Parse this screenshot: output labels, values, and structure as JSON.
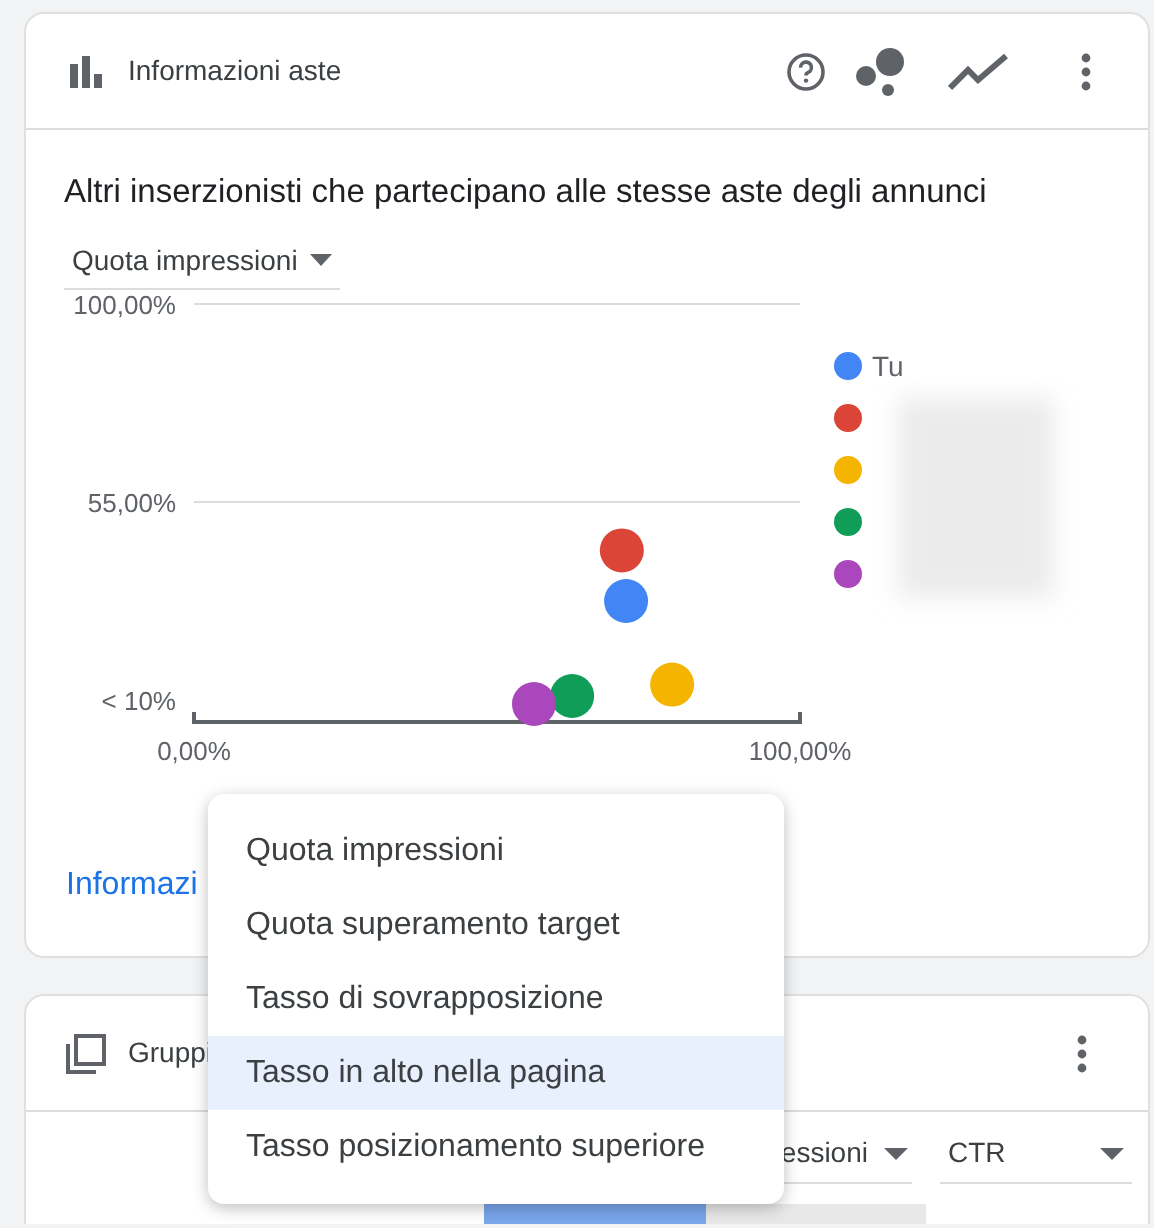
{
  "auction_card": {
    "title": "Informazioni aste",
    "heading": "Altri inserzionisti che partecipano alle stesse aste degli annunci",
    "metric_dropdown": "Quota impressioni",
    "link": "Informazi",
    "chart_data": {
      "type": "scatter",
      "xlim": [
        0,
        100
      ],
      "ylim": [
        5,
        100
      ],
      "xticks": [
        {
          "value": 0,
          "label": "0,00%"
        },
        {
          "value": 100,
          "label": "100,00%"
        }
      ],
      "yticks": [
        {
          "value": 10,
          "label": "< 10%"
        },
        {
          "value": 55,
          "label": "55,00%"
        },
        {
          "value": 100,
          "label": "100,00%"
        }
      ],
      "series": [
        {
          "name": "Tu",
          "color": "#4285f4",
          "x": [
            71.3
          ],
          "values": [
            32.5
          ]
        },
        {
          "color": "#db4437",
          "x": [
            70.6
          ],
          "values": [
            44
          ]
        },
        {
          "color": "#f4b400",
          "x": [
            78.9
          ],
          "values": [
            13.5
          ]
        },
        {
          "color": "#0f9d58",
          "x": [
            62.4
          ],
          "values": [
            10.9
          ]
        },
        {
          "color": "#ab47bc",
          "x": [
            56.1
          ],
          "values": [
            9.1
          ]
        }
      ]
    }
  },
  "menu": [
    {
      "label": "Quota impressioni",
      "selected": false
    },
    {
      "label": "Quota superamento target",
      "selected": false
    },
    {
      "label": "Tasso di sovrapposizione",
      "selected": false
    },
    {
      "label": "Tasso in alto nella pagina",
      "selected": true
    },
    {
      "label": "Tasso posizionamento superiore",
      "selected": false
    }
  ],
  "second_card": {
    "title": "Gruppi",
    "column_dropdowns": [
      "essioni",
      "CTR"
    ]
  }
}
